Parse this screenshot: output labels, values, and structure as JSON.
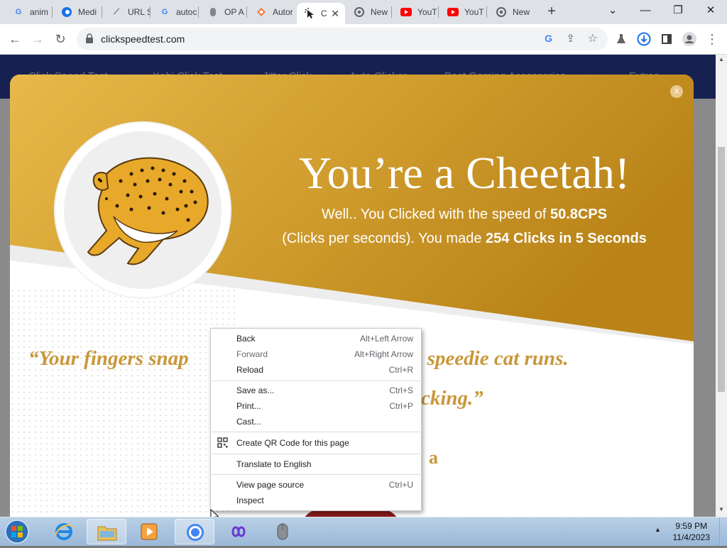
{
  "browser": {
    "tabs": [
      {
        "title": "anim",
        "favicon": "G",
        "color": "#4285f4"
      },
      {
        "title": "Medi",
        "favicon": "edge",
        "color": "#1a73e8"
      },
      {
        "title": "URL S",
        "favicon": "link",
        "color": "#5f6368"
      },
      {
        "title": "autoc",
        "favicon": "G",
        "color": "#4285f4"
      },
      {
        "title": "OP A",
        "favicon": "mouse",
        "color": "#5f6368"
      },
      {
        "title": "Autor",
        "favicon": "diamond",
        "color": "#f07b3f"
      },
      {
        "title": "C",
        "favicon": "cursor",
        "color": "#202124"
      },
      {
        "title": "New",
        "favicon": "chrome",
        "color": "#5f6368"
      },
      {
        "title": "YouT",
        "favicon": "youtube",
        "color": "#ff0000"
      },
      {
        "title": "YouT",
        "favicon": "youtube",
        "color": "#ff0000"
      },
      {
        "title": "New",
        "favicon": "chrome",
        "color": "#5f6368"
      }
    ],
    "url": "clickspeedtest.com"
  },
  "site_nav": [
    "Click Speed Test",
    "Kohi Click Test",
    "Jitter Click",
    "Auto Clicker",
    "Best Gaming Accessories",
    "Extras"
  ],
  "modal": {
    "close_label": "X",
    "title": "You’re a Cheetah!",
    "line1_prefix": "Well.. You Clicked with the speed of ",
    "line1_value": "50.8CPS",
    "line2_prefix": "(Clicks per seconds). You made ",
    "line2_value": "254 Clicks in 5 Seconds",
    "quote_part1": "“Your fingers snap",
    "quote_part2": "st like the speedie cat runs.",
    "quote_part3": "cking.”",
    "quote_fragment": "a"
  },
  "context_menu": {
    "items": [
      {
        "label": "Back",
        "shortcut": "Alt+Left Arrow"
      },
      {
        "label": "Forward",
        "shortcut": "Alt+Right Arrow"
      },
      {
        "label": "Reload",
        "shortcut": "Ctrl+R"
      },
      {
        "label": "Save as...",
        "shortcut": "Ctrl+S"
      },
      {
        "label": "Print...",
        "shortcut": "Ctrl+P"
      },
      {
        "label": "Cast...",
        "shortcut": ""
      },
      {
        "label": "Create QR Code for this page",
        "shortcut": ""
      },
      {
        "label": "Translate to English",
        "shortcut": ""
      },
      {
        "label": "View page source",
        "shortcut": "Ctrl+U"
      },
      {
        "label": "Inspect",
        "shortcut": ""
      }
    ]
  },
  "taskbar": {
    "time": "9:59 PM",
    "date": "11/4/2023"
  },
  "colors": {
    "banner_gold": "#c9952d",
    "quote_gold": "#c9973a",
    "nav_blue": "#283a93"
  }
}
